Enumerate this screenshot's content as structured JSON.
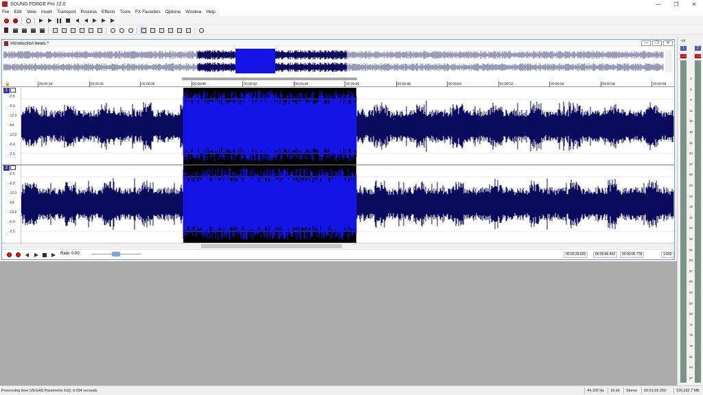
{
  "app": {
    "title": "SOUND FORGE Pro 12.0"
  },
  "menu": [
    "File",
    "Edit",
    "View",
    "Insert",
    "Transport",
    "Process",
    "Effects",
    "Tools",
    "FX Favorites",
    "Options",
    "Window",
    "Help"
  ],
  "window_controls": {
    "minimize": "—",
    "restore": "❐",
    "close": "✕"
  },
  "toolbar1_icons": [
    "record-icon",
    "record-options-icon",
    "loop-icon",
    "play-all-icon",
    "play-icon",
    "pause-icon",
    "stop-icon",
    "go-to-start-icon",
    "rewind-icon",
    "forward-icon",
    "go-to-end-icon",
    "next-marker-icon"
  ],
  "toolbar2_icons": [
    "new-file-icon",
    "open-file-icon",
    "save-icon",
    "save-as-icon",
    "render-icon",
    "cut-icon",
    "copy-icon",
    "paste-icon",
    "paste-mix-icon",
    "trim-icon",
    "crop-icon",
    "undo-icon",
    "redo-icon",
    "repeat-icon",
    "edit-tool-icon",
    "magnify-tool-icon",
    "pencil-tool-icon",
    "envelope-tool-icon",
    "event-tool-icon",
    "snap-icon",
    "scrub-icon"
  ],
  "data_window": {
    "title": "Introduction beats *",
    "ctrl_min": "—",
    "ctrl_max": "❐",
    "ctrl_close": "✕",
    "ruler": [
      "00:00:34",
      "00:00:36",
      "00:00:38",
      "00:00:40",
      "00:00:42",
      "00:00:44",
      "00:00:46",
      "00:00:48",
      "00:00:50",
      "00:00:52",
      "00:00:54",
      "00:00:56",
      "00:00:58"
    ],
    "channels": [
      {
        "num": "1",
        "db": [
          "-2.5",
          "-6.0",
          "-12.0",
          "-Inf.",
          "-12.0",
          "-6.0",
          "-2.5"
        ]
      },
      {
        "num": "2",
        "db": [
          "-2.5",
          "-6.0",
          "-12.0",
          "-Inf.",
          "-12.0",
          "-6.0",
          "-2.5"
        ]
      }
    ],
    "rate_label": "Rate: 0.00",
    "sel_start": "00:00:39.625",
    "sel_end": "00:00:46.403",
    "sel_length": "00:00:06.778",
    "zoom": "1:632"
  },
  "meters": {
    "left_label": "1",
    "right_label": "2",
    "peak_left": "-1.5",
    "peak_right": "-1.5",
    "top_label": "-Inf",
    "scale": [
      "3",
      "6",
      "9",
      "12",
      "15",
      "18",
      "21",
      "24",
      "27",
      "30",
      "33",
      "36",
      "39",
      "42",
      "45",
      "48",
      "51",
      "54",
      "57",
      "60",
      "63",
      "66",
      "69",
      "72",
      "75",
      "78",
      "81",
      "84",
      "87"
    ]
  },
  "status": {
    "message": "Processing time (VEGAS Parametric EQ): 0.094 seconds",
    "sample_rate": "44,100 Hz",
    "bit_depth": "16 bit",
    "channels": "Stereo",
    "duration": "00:01:55.252",
    "size": "116,182.7 MB"
  },
  "colors": {
    "waveform": "#0a0a5c",
    "selection_bg": "#000000",
    "selection_wave": "#1414e6",
    "accent": "#3a3a9a"
  }
}
